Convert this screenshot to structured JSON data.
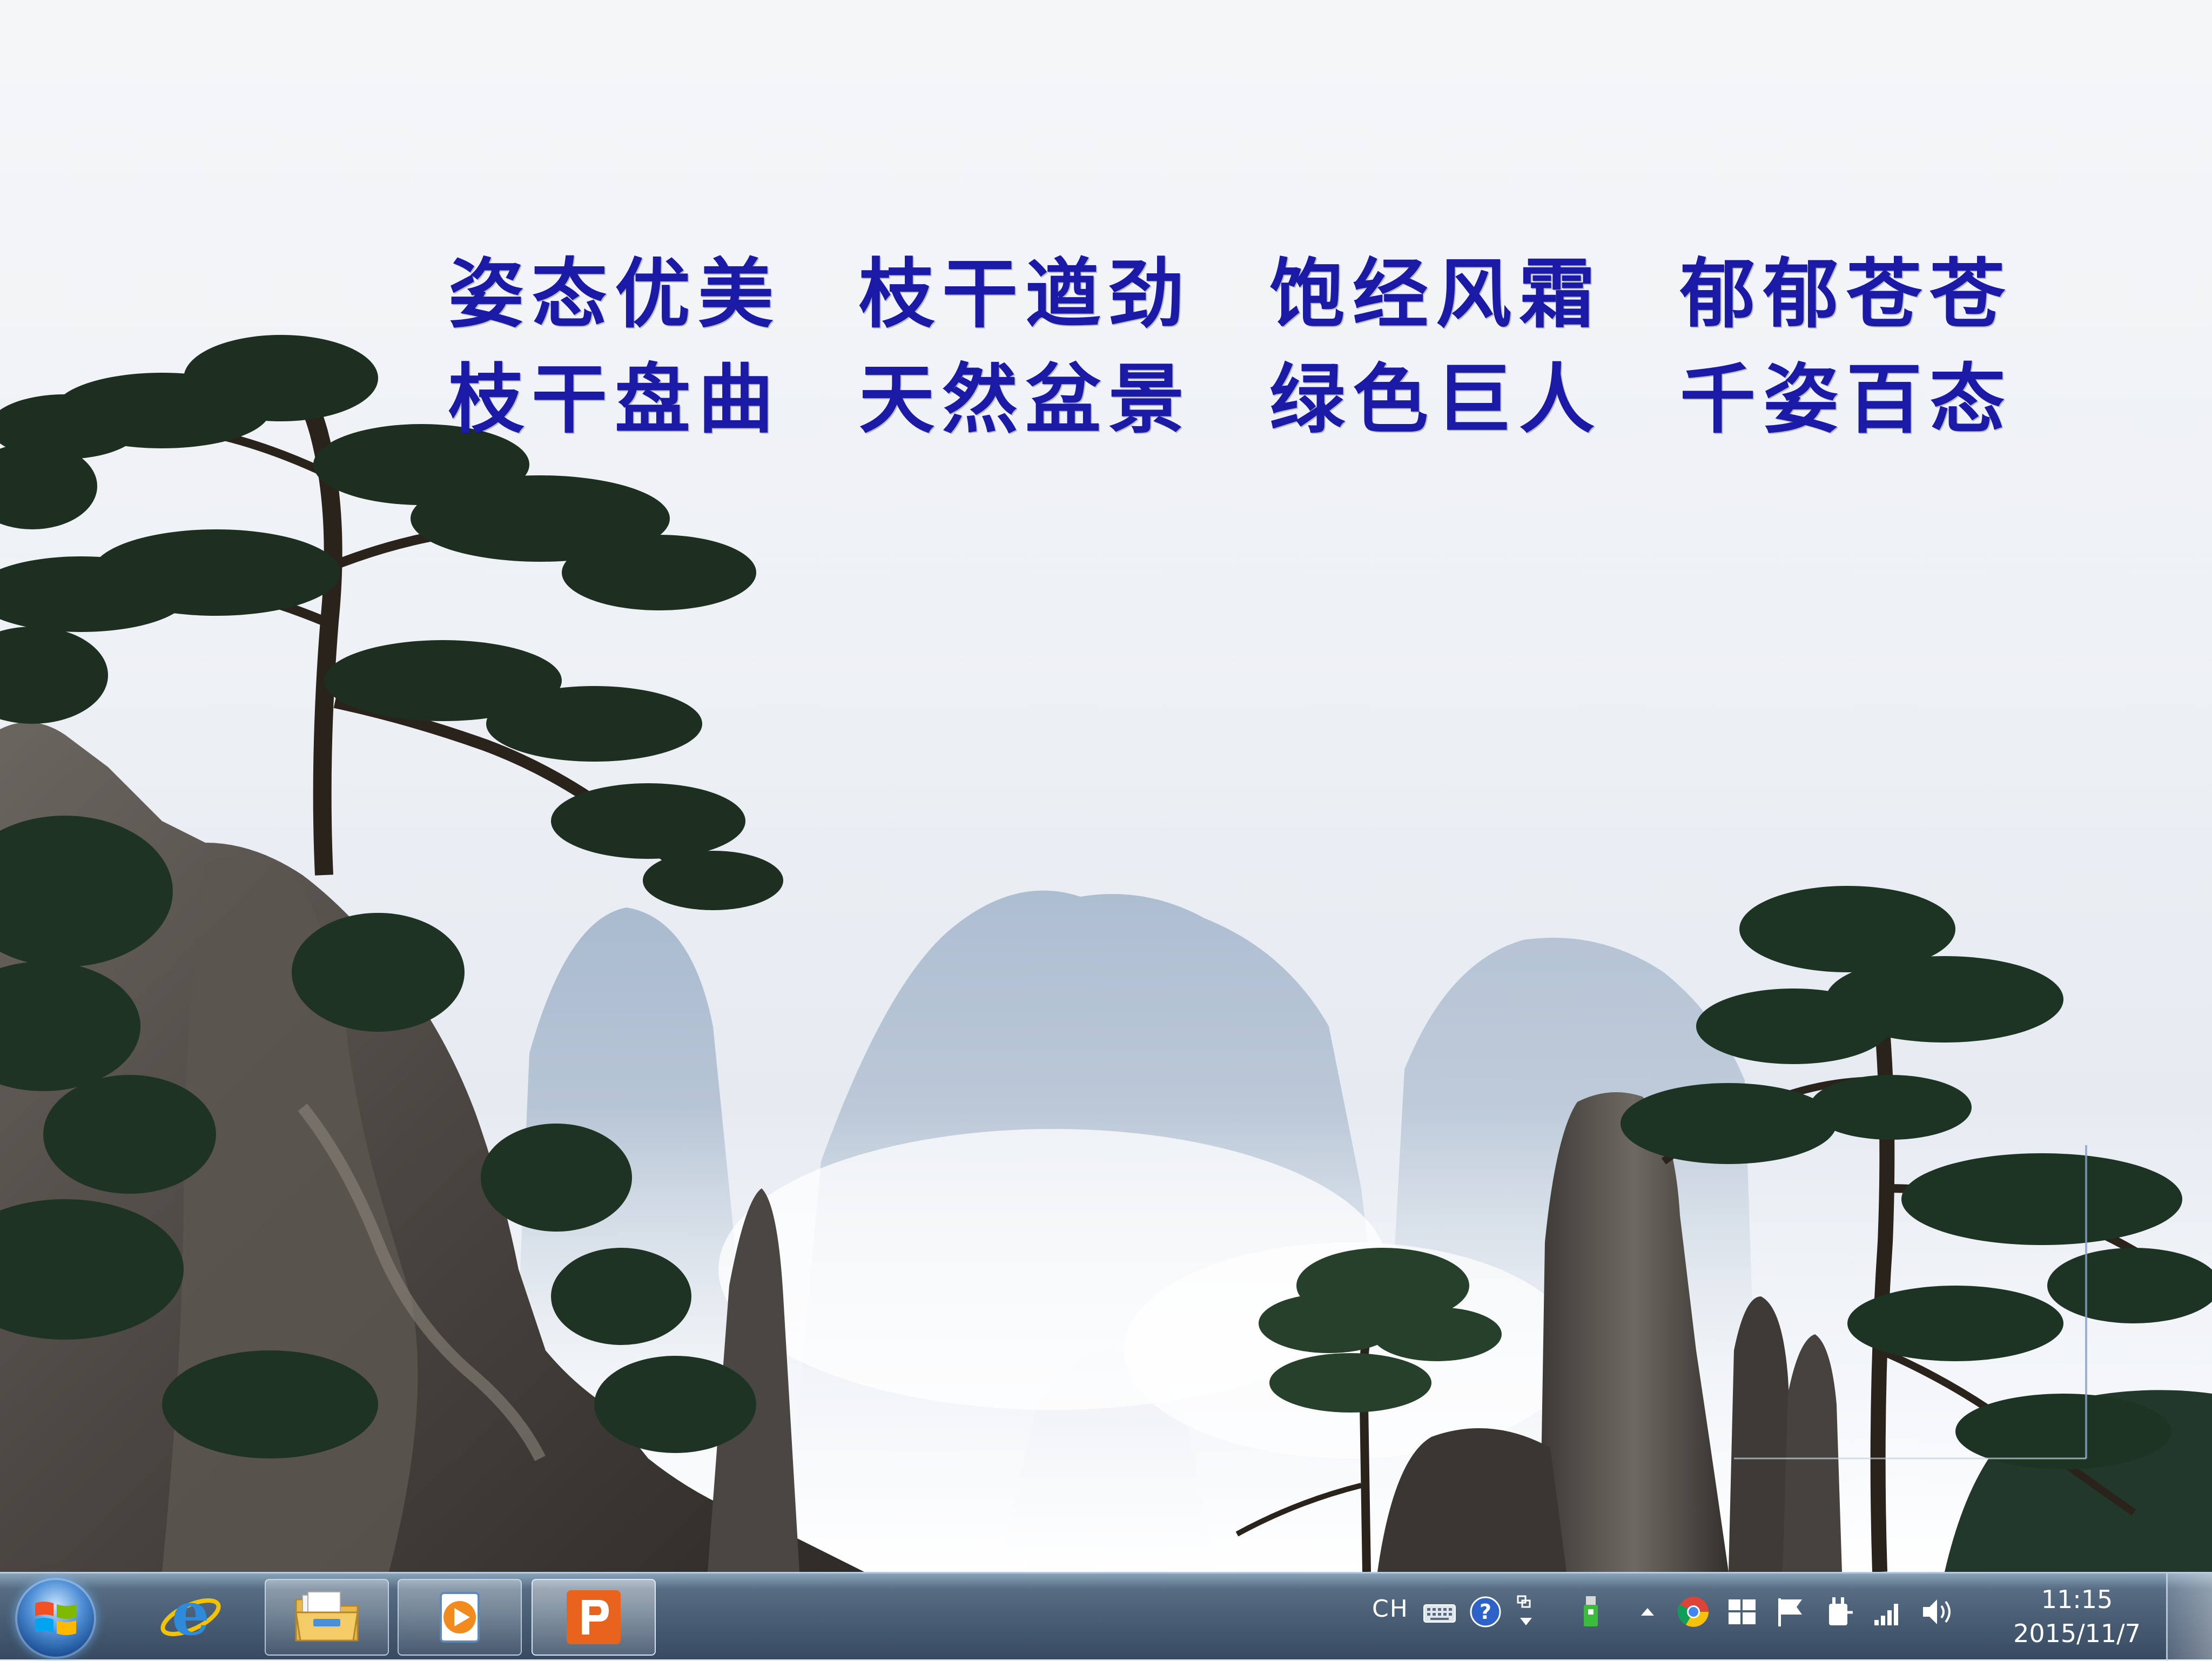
{
  "poem": {
    "row1": [
      "姿态优美",
      "枝干遒劲",
      "饱经风霜",
      "郁郁苍苍"
    ],
    "row2": [
      "枝干盘曲",
      "天然盆景",
      "绿色巨人",
      "千姿百态"
    ]
  },
  "taskbar": {
    "apps": [
      {
        "name": "internet-explorer",
        "icon": "ie-icon"
      },
      {
        "name": "windows-explorer",
        "icon": "folder-icon"
      },
      {
        "name": "media-player",
        "icon": "media-player-icon"
      },
      {
        "name": "powerpoint",
        "icon": "powerpoint-icon"
      }
    ],
    "tray": {
      "language": "CH",
      "icons": [
        "keyboard-icon",
        "help-icon",
        "ime-settings-icon",
        "usb-icon",
        "show-hidden-icons-icon",
        "chrome-icon",
        "windows-icon",
        "action-center-flag-icon",
        "power-icon",
        "network-signal-icon",
        "volume-icon"
      ]
    },
    "clock": {
      "time": "11:15",
      "date": "2015/11/7"
    }
  },
  "colors": {
    "poem_text": "#1a1aa6",
    "taskbar": "#2f4a66",
    "sky": "#eef1f5"
  }
}
